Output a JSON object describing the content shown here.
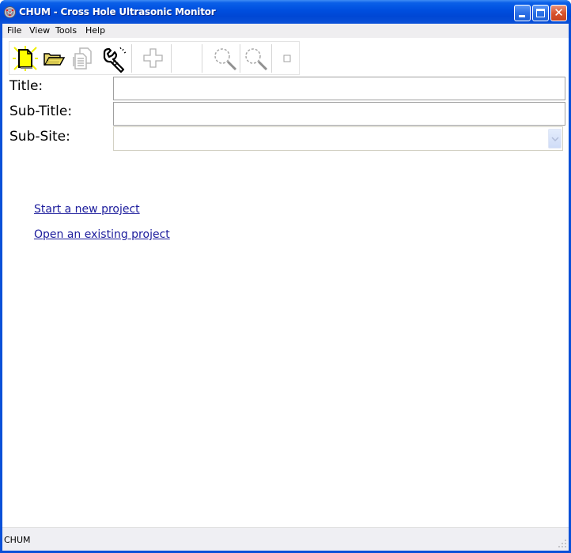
{
  "window": {
    "title": "CHUM - Cross Hole Ultrasonic Monitor",
    "app_icon": "chum-app-icon",
    "controls": {
      "minimize": "minimize-icon",
      "maximize": "maximize-icon",
      "close_glyph": "✕"
    }
  },
  "menubar": {
    "items": [
      {
        "label": "File"
      },
      {
        "label": "View"
      },
      {
        "label": "Tools"
      },
      {
        "label": "Help"
      }
    ]
  },
  "toolbar": {
    "buttons": [
      {
        "name": "new-project-button",
        "icon": "new-document-icon",
        "enabled": true
      },
      {
        "name": "open-project-button",
        "icon": "open-folder-icon",
        "enabled": true
      },
      {
        "name": "copy-button",
        "icon": "copy-document-icon",
        "enabled": false
      },
      {
        "name": "settings-button",
        "icon": "wrench-icon",
        "enabled": true
      },
      {
        "name": "add-button",
        "icon": "plus-icon",
        "enabled": false
      },
      {
        "name": "zoom-in-button",
        "icon": "magnifier-icon",
        "enabled": false
      },
      {
        "name": "zoom-out-button",
        "icon": "magnifier-icon",
        "enabled": false
      },
      {
        "name": "stop-button",
        "icon": "square-icon",
        "enabled": false
      }
    ]
  },
  "form": {
    "title_label": "Title:",
    "title_value": "",
    "subtitle_label": "Sub-Title:",
    "subtitle_value": "",
    "subsite_label": "Sub-Site:",
    "subsite_value": ""
  },
  "links": {
    "start_new": "Start a new project",
    "open_existing": "Open an existing project"
  },
  "statusbar": {
    "text": "CHUM"
  },
  "colors": {
    "titlebar": "#0a50d8",
    "link": "#1c1c9c",
    "close_button": "#d9542e",
    "new_icon_yellow": "#ffff00"
  }
}
